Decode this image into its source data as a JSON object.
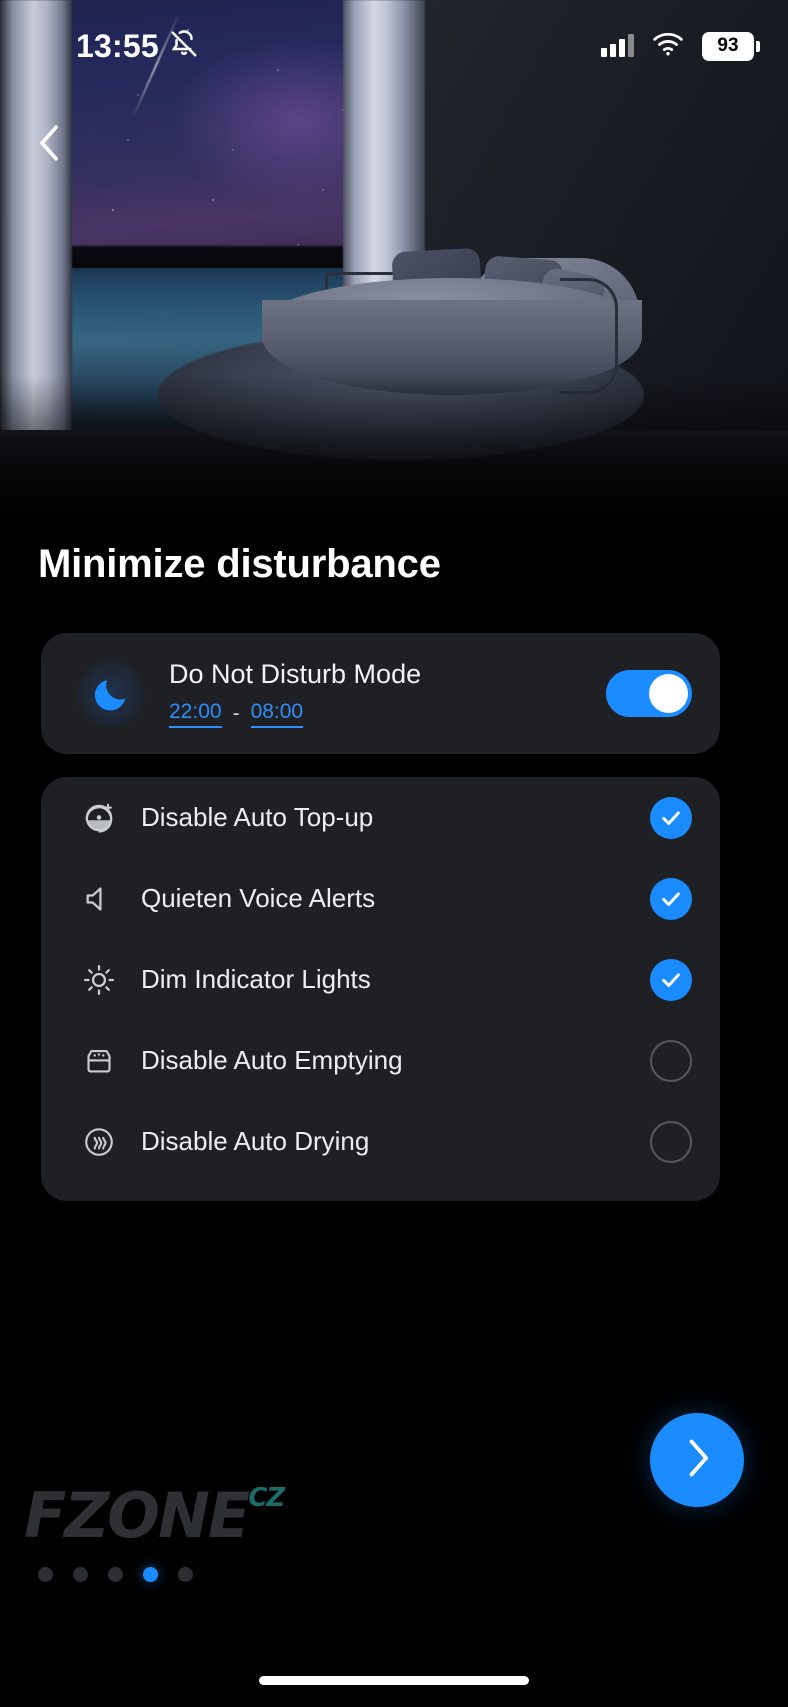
{
  "statusbar": {
    "time": "13:55",
    "mute_icon": "bell-muted-icon",
    "signal_icon": "signal-bars-icon",
    "wifi_icon": "wifi-icon",
    "battery_level": "93"
  },
  "nav": {
    "back_icon": "chevron-left-icon"
  },
  "hero": {
    "alt": "dark bedroom with round sofa at night"
  },
  "page": {
    "title": "Minimize disturbance"
  },
  "dnd": {
    "icon": "moon-icon",
    "title": "Do Not Disturb Mode",
    "start_time": "22:00",
    "separator": "-",
    "end_time": "08:00",
    "toggle_on": true
  },
  "options": [
    {
      "icon": "auto-topup-icon",
      "label": "Disable Auto Top-up",
      "checked": true
    },
    {
      "icon": "speaker-icon",
      "label": "Quieten Voice Alerts",
      "checked": true
    },
    {
      "icon": "brightness-icon",
      "label": "Dim Indicator Lights",
      "checked": true
    },
    {
      "icon": "dustbin-icon",
      "label": "Disable Auto Emptying",
      "checked": false
    },
    {
      "icon": "steam-dry-icon",
      "label": "Disable Auto Drying",
      "checked": false
    }
  ],
  "pager": {
    "count": 5,
    "active_index": 3
  },
  "fab": {
    "icon": "chevron-right-icon",
    "label": "Next"
  },
  "watermark": {
    "text": "FZONE",
    "suffix": "CZ"
  },
  "colors": {
    "accent": "#1a8cff",
    "link": "#2f8dfb",
    "card": "#1e2023",
    "background": "#000000",
    "text_primary": "#ffffff"
  }
}
